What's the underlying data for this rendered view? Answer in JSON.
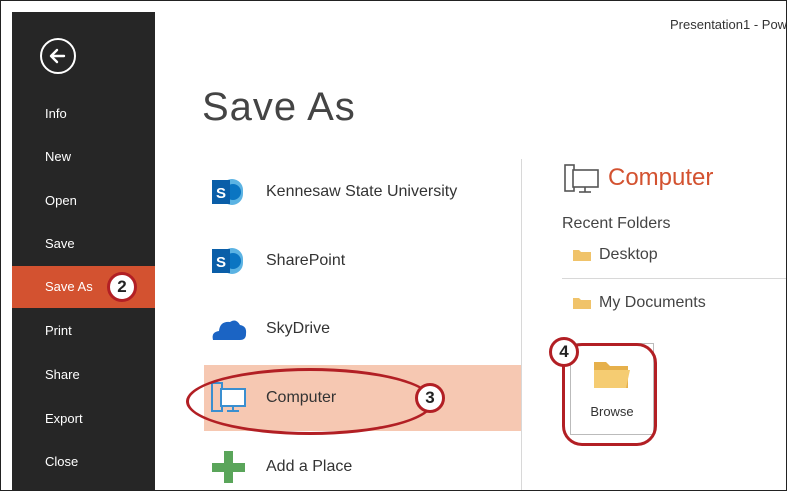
{
  "window": {
    "title": "Presentation1 - Pow"
  },
  "page": {
    "title": "Save As"
  },
  "sidebar": {
    "back_icon": "back-arrow-icon",
    "items": [
      {
        "label": "Info"
      },
      {
        "label": "New"
      },
      {
        "label": "Open"
      },
      {
        "label": "Save"
      },
      {
        "label": "Save As",
        "active": true
      },
      {
        "label": "Print"
      },
      {
        "label": "Share"
      },
      {
        "label": "Export"
      },
      {
        "label": "Close"
      }
    ]
  },
  "places": [
    {
      "label": "Kennesaw State University",
      "icon": "sharepoint-icon"
    },
    {
      "label": "SharePoint",
      "icon": "sharepoint-icon"
    },
    {
      "label": "SkyDrive",
      "icon": "cloud-icon"
    },
    {
      "label": "Computer",
      "icon": "computer-icon",
      "selected": true
    },
    {
      "label": "Add a Place",
      "icon": "plus-icon"
    }
  ],
  "right_panel": {
    "title": "Computer",
    "icon": "computer-icon",
    "recent_heading": "Recent Folders",
    "folders": [
      {
        "label": "Desktop"
      },
      {
        "label": "My Documents"
      }
    ],
    "browse_label": "Browse"
  },
  "callouts": {
    "two": "2",
    "three": "3",
    "four": "4"
  },
  "colors": {
    "sidebar_bg": "#262626",
    "accent": "#d35230",
    "selected_bg": "#f6c8b2",
    "callout_red": "#b21f24"
  }
}
